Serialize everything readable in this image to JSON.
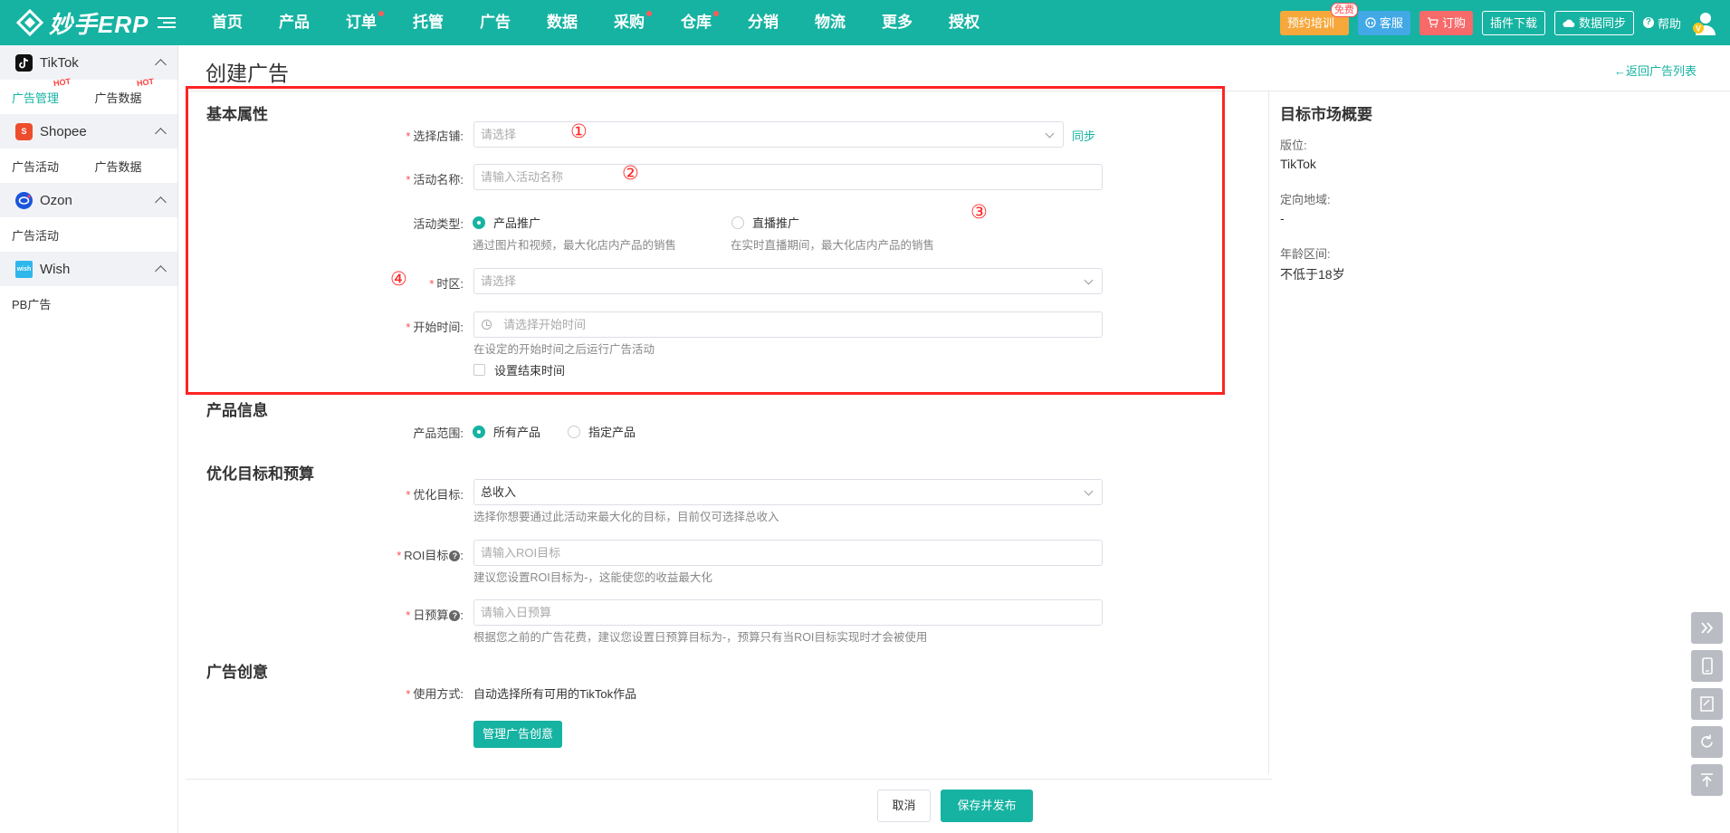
{
  "app": {
    "logo_text": "妙手ERP"
  },
  "nav": [
    {
      "label": "首页",
      "dot": false
    },
    {
      "label": "产品",
      "dot": false
    },
    {
      "label": "订单",
      "dot": true
    },
    {
      "label": "托管",
      "dot": false
    },
    {
      "label": "广告",
      "dot": false
    },
    {
      "label": "数据",
      "dot": false
    },
    {
      "label": "采购",
      "dot": true
    },
    {
      "label": "仓库",
      "dot": true
    },
    {
      "label": "分销",
      "dot": false
    },
    {
      "label": "物流",
      "dot": false
    },
    {
      "label": "更多",
      "dot": false
    },
    {
      "label": "授权",
      "dot": false
    }
  ],
  "topright": {
    "training": "预约培训",
    "free_badge": "免费",
    "service": "客服",
    "order": "订购",
    "plugin": "插件下载",
    "sync": "数据同步",
    "help": "帮助"
  },
  "sidebar": {
    "hot": "HOT",
    "groups": [
      {
        "name": "TikTok",
        "items": [
          "广告管理",
          "广告数据"
        ]
      },
      {
        "name": "Shopee",
        "items": [
          "广告活动",
          "广告数据"
        ]
      },
      {
        "name": "Ozon",
        "items": [
          "广告活动"
        ]
      },
      {
        "name": "Wish",
        "items": [
          "PB广告"
        ]
      }
    ],
    "wish_icon_text": "wish"
  },
  "page": {
    "title": "创建广告",
    "back": "←返回广告列表"
  },
  "basic": {
    "title": "基本属性",
    "shop_label": "选择店铺:",
    "shop_placeholder": "请选择",
    "sync": "同步",
    "name_label": "活动名称:",
    "name_placeholder": "请输入活动名称",
    "type_label": "活动类型:",
    "type_product": "产品推广",
    "type_product_hint": "通过图片和视频，最大化店内产品的销售",
    "type_live": "直播推广",
    "type_live_hint": "在实时直播期间，最大化店内产品的销售",
    "tz_label": "时区:",
    "tz_placeholder": "请选择",
    "start_label": "开始时间:",
    "start_placeholder": "请选择开始时间",
    "start_hint": "在设定的开始时间之后运行广告活动",
    "end_checkbox": "设置结束时间"
  },
  "annotations": [
    "①",
    "②",
    "③",
    "④"
  ],
  "product": {
    "title": "产品信息",
    "range_label": "产品范围:",
    "all": "所有产品",
    "specific": "指定产品"
  },
  "optimize": {
    "title": "优化目标和预算",
    "goal_label": "优化目标:",
    "goal_value": "总收入",
    "goal_hint": "选择你想要通过此活动来最大化的目标，目前仅可选择总收入",
    "roi_label": "ROI目标",
    "roi_placeholder": "请输入ROI目标",
    "roi_hint": "建议您设置ROI目标为-，这能使您的收益最大化",
    "budget_label": "日预算",
    "budget_placeholder": "请输入日预算",
    "budget_hint": "根据您之前的广告花费，建议您设置日预算目标为-，预算只有当ROI目标实现时才会被使用"
  },
  "creative": {
    "title": "广告创意",
    "mode_label": "使用方式:",
    "mode_value": "自动选择所有可用的TikTok作品",
    "manage_button": "管理广告创意"
  },
  "summary": {
    "title": "目标市场概要",
    "placement_label": "版位:",
    "placement_value": "TikTok",
    "region_label": "定向地域:",
    "region_value": "-",
    "age_label": "年龄区间:",
    "age_value": "不低于18岁"
  },
  "footer": {
    "cancel": "取消",
    "save": "保存并发布"
  },
  "colors": {
    "brand": "#16b3a2",
    "highlight": "#ff2323",
    "required": "#ff4d4f"
  }
}
